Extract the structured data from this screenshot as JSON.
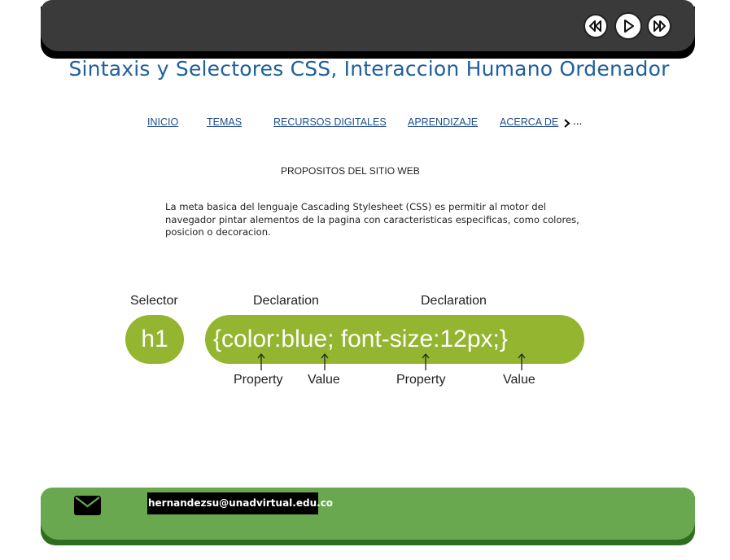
{
  "header": {
    "controls": [
      {
        "name": "rewind",
        "icon": "rewind-icon"
      },
      {
        "name": "play",
        "icon": "play-icon"
      },
      {
        "name": "fast-forward",
        "icon": "fast-forward-icon"
      }
    ]
  },
  "site_title": "Sintaxis y Selectores CSS, Interaccion Humano Ordenador",
  "nav": {
    "items": [
      "INICIO",
      "TEMAS",
      "RECURSOS DIGITALES",
      "APRENDIZAJE",
      "ACERCA DE"
    ],
    "more_label": "..."
  },
  "section_title": "PROPOSITOS DEL SITIO WEB",
  "intro_text": "La meta basica del lenguaje Cascading Stylesheet (CSS)  es permitir al motor del navegador pintar alementos de la pagina con caracteristicas especificas, como colores, posicion o decoracion.",
  "diagram": {
    "selector_label": "Selector",
    "declaration_labels": [
      "Declaration",
      "Declaration"
    ],
    "selector_text": "h1",
    "declaration_text": "{color:blue; font-size:12px;}",
    "bottom_labels": [
      "Property",
      "Value",
      "Property",
      "Value"
    ],
    "pill_color": "#93b52f"
  },
  "footer": {
    "email": "hernandezsu@unadvirtual.edu.co",
    "icon": "mail-icon",
    "color": "#6aa84f"
  }
}
